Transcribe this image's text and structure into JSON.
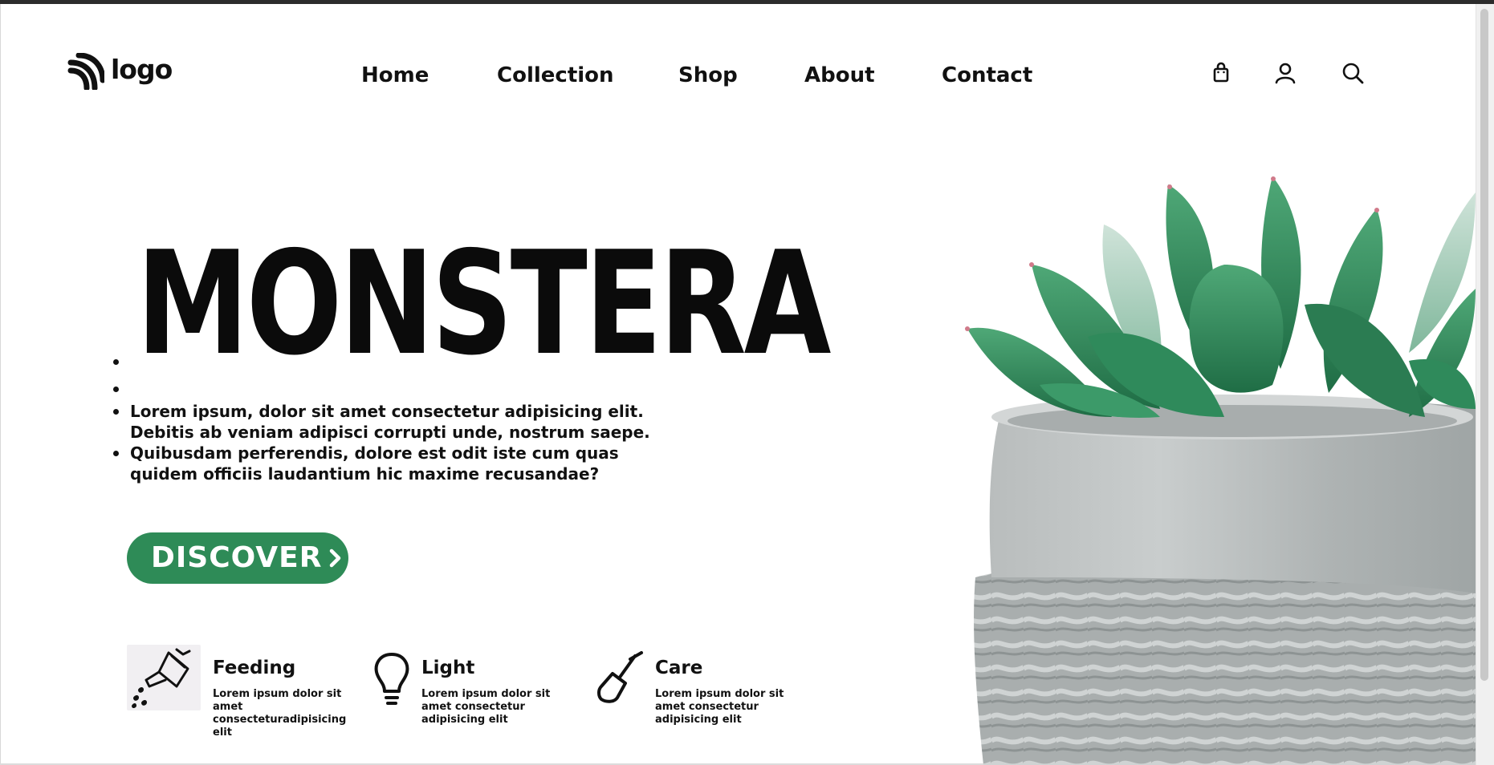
{
  "header": {
    "logo_text": "logo",
    "nav": [
      "Home",
      "Collection",
      "Shop",
      "About",
      "Contact"
    ],
    "icons": [
      "shopping-bag-icon",
      "user-icon",
      "search-icon"
    ]
  },
  "hero": {
    "title": "MONSTERA",
    "paragraphs": [
      "Lorem ipsum, dolor sit amet consectetur adipisicing elit. Debitis ab veniam adipisci corrupti unde, nostrum saepe.",
      "Quibusdam perferendis, dolore est odit iste cum quas quidem officiis laudantium hic maxime recusandae?"
    ],
    "button_label": "DISCOVER",
    "button_color": "#2e8b57"
  },
  "features": [
    {
      "title": "Feeding",
      "desc": "Lorem ipsum dolor sit amet consecteturadipisicing elit",
      "icon": "watering-can-icon"
    },
    {
      "title": "Light",
      "desc": "Lorem ipsum dolor sit amet consectetur adipisicing elit",
      "icon": "lightbulb-icon"
    },
    {
      "title": "Care",
      "desc": "Lorem ipsum dolor sit amet consectetur adipisicing elit",
      "icon": "shovel-icon"
    }
  ]
}
